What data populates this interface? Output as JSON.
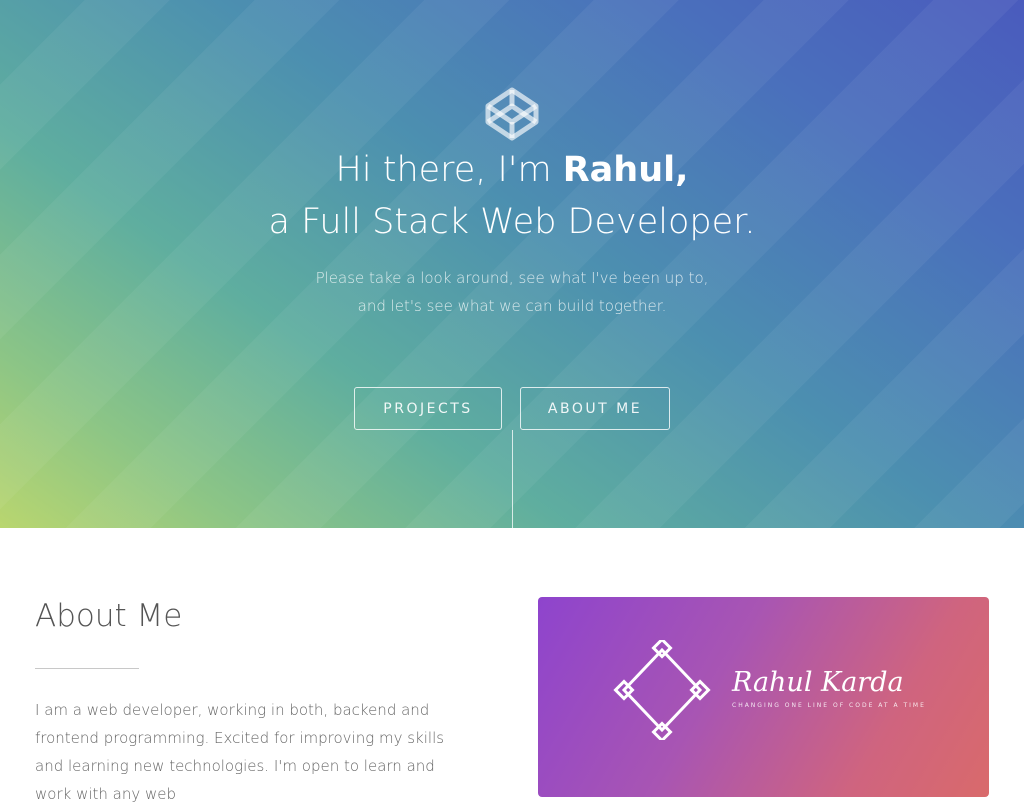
{
  "hero": {
    "greeting": "Hi there, I'm ",
    "name": "Rahul,",
    "role": "a Full Stack Web Developer.",
    "tagline_line1": "Please take a look around, see what I've been up to,",
    "tagline_line2": "and let's see what we can build together.",
    "buttons": {
      "projects": "PROJECTS",
      "about": "ABOUT ME"
    },
    "logo_icon": "codepen-icon"
  },
  "about": {
    "title": "About Me",
    "text": "I am a web developer, working in both, backend and frontend programming. Excited for improving my skills and learning new technologies. I'm open to learn and work with any web"
  },
  "card": {
    "name": "Rahul Karda",
    "tagline": "CHANGING ONE LINE OF CODE AT A TIME",
    "logo_icon": "diamond-logo-icon"
  },
  "colors": {
    "hero_start": "#b9d66f",
    "hero_end": "#4a5bbd",
    "card_start": "#8e44cd",
    "card_end": "#d96a6b"
  }
}
